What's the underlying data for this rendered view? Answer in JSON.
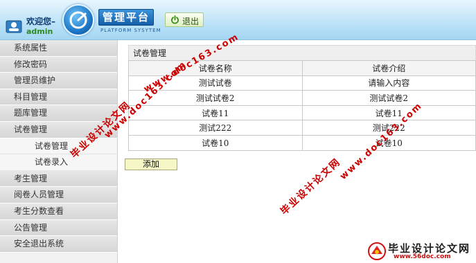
{
  "header": {
    "welcome": "欢迎您–",
    "username": "admin",
    "brand_title": "管理平台",
    "brand_subtitle": "PLATFORM SYSYTEM",
    "logout_label": "退出"
  },
  "sidebar": {
    "items": [
      {
        "label": "系统属性"
      },
      {
        "label": "修改密码"
      },
      {
        "label": "管理员维护"
      },
      {
        "label": "科目管理"
      },
      {
        "label": "题库管理"
      },
      {
        "label": "试卷管理"
      },
      {
        "label": "试卷管理",
        "sub": true
      },
      {
        "label": "试卷录入",
        "sub": true
      },
      {
        "label": "考生管理"
      },
      {
        "label": "阅卷人员管理"
      },
      {
        "label": "考生分数查看"
      },
      {
        "label": "公告管理"
      },
      {
        "label": "安全退出系统"
      }
    ]
  },
  "main": {
    "panel_title": "试卷管理",
    "columns": [
      "试卷名称",
      "试卷介绍"
    ],
    "rows": [
      [
        "测试试卷",
        "请输入内容"
      ],
      [
        "测试试卷2",
        "测试试卷2"
      ],
      [
        "试卷11",
        "试卷11"
      ],
      [
        "测试222",
        "测试222"
      ],
      [
        "试卷10",
        "试卷10"
      ]
    ],
    "add_label": "添加"
  },
  "watermarks": {
    "cn": "毕业设计论文网",
    "url": "www.doc163.com"
  },
  "footer_logo": {
    "text": "毕业设计论文网",
    "url": "www.56doc.com"
  },
  "colors": {
    "header_bg": "#bfe4f8",
    "brand_blue": "#155fa8",
    "watermark_red": "#cc0000",
    "sidebar_bg": "#d6d6d6"
  }
}
